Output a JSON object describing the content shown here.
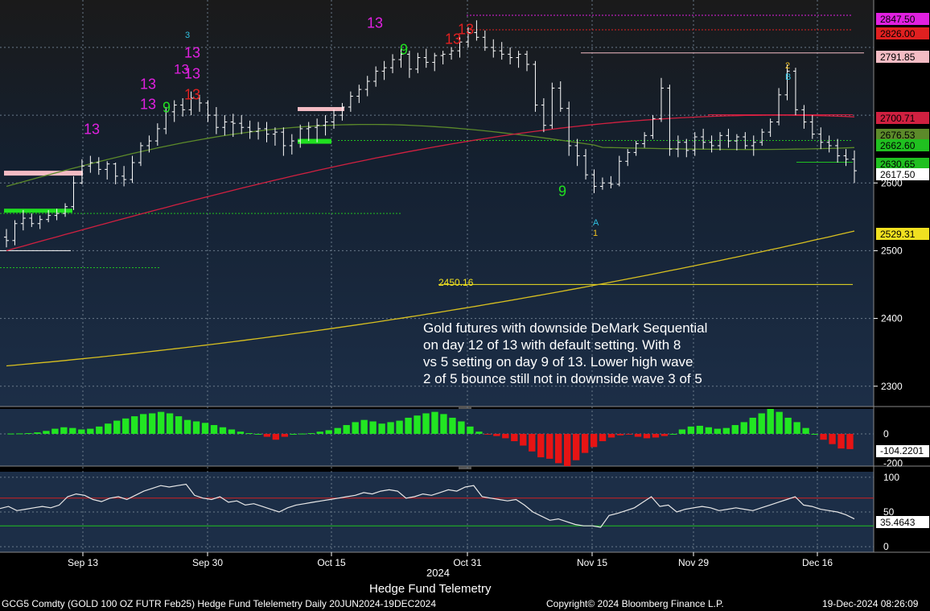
{
  "chart_data": [
    {
      "type": "candlestick",
      "panel": "price",
      "yticks": [
        2300,
        2400,
        2500,
        2600
      ],
      "ylim": [
        2270,
        2870
      ],
      "ohlc": [
        [
          2520,
          2532,
          2505,
          2515
        ],
        [
          2515,
          2545,
          2508,
          2540
        ],
        [
          2540,
          2560,
          2530,
          2548
        ],
        [
          2548,
          2555,
          2535,
          2540
        ],
        [
          2540,
          2552,
          2532,
          2546
        ],
        [
          2546,
          2560,
          2542,
          2552
        ],
        [
          2552,
          2562,
          2545,
          2555
        ],
        [
          2555,
          2570,
          2550,
          2565
        ],
        [
          2565,
          2610,
          2560,
          2600
        ],
        [
          2600,
          2635,
          2598,
          2625
        ],
        [
          2625,
          2640,
          2615,
          2630
        ],
        [
          2630,
          2638,
          2612,
          2620
        ],
        [
          2620,
          2632,
          2605,
          2628
        ],
        [
          2628,
          2630,
          2598,
          2610
        ],
        [
          2610,
          2625,
          2595,
          2605
        ],
        [
          2605,
          2640,
          2600,
          2630
        ],
        [
          2630,
          2660,
          2625,
          2655
        ],
        [
          2655,
          2670,
          2645,
          2662
        ],
        [
          2662,
          2688,
          2655,
          2680
        ],
        [
          2680,
          2712,
          2672,
          2705
        ],
        [
          2705,
          2722,
          2690,
          2715
        ],
        [
          2715,
          2725,
          2698,
          2708
        ],
        [
          2708,
          2735,
          2700,
          2725
        ],
        [
          2725,
          2730,
          2705,
          2718
        ],
        [
          2718,
          2722,
          2690,
          2700
        ],
        [
          2700,
          2712,
          2672,
          2682
        ],
        [
          2682,
          2700,
          2670,
          2690
        ],
        [
          2690,
          2702,
          2668,
          2688
        ],
        [
          2688,
          2700,
          2672,
          2682
        ],
        [
          2682,
          2692,
          2665,
          2676
        ],
        [
          2676,
          2690,
          2664,
          2680
        ],
        [
          2680,
          2690,
          2660,
          2672
        ],
        [
          2672,
          2682,
          2655,
          2675
        ],
        [
          2675,
          2682,
          2640,
          2655
        ],
        [
          2655,
          2672,
          2642,
          2662
        ],
        [
          2662,
          2686,
          2652,
          2680
        ],
        [
          2680,
          2690,
          2662,
          2682
        ],
        [
          2682,
          2695,
          2660,
          2685
        ],
        [
          2685,
          2700,
          2670,
          2690
        ],
        [
          2690,
          2708,
          2680,
          2700
        ],
        [
          2700,
          2718,
          2692,
          2712
        ],
        [
          2712,
          2735,
          2705,
          2728
        ],
        [
          2728,
          2745,
          2718,
          2738
        ],
        [
          2738,
          2758,
          2728,
          2750
        ],
        [
          2750,
          2772,
          2742,
          2765
        ],
        [
          2765,
          2780,
          2752,
          2770
        ],
        [
          2770,
          2790,
          2762,
          2782
        ],
        [
          2782,
          2800,
          2770,
          2790
        ],
        [
          2790,
          2795,
          2755,
          2768
        ],
        [
          2768,
          2792,
          2762,
          2785
        ],
        [
          2785,
          2798,
          2770,
          2778
        ],
        [
          2778,
          2792,
          2765,
          2788
        ],
        [
          2788,
          2795,
          2775,
          2790
        ],
        [
          2790,
          2800,
          2782,
          2795
        ],
        [
          2795,
          2815,
          2785,
          2808
        ],
        [
          2808,
          2830,
          2800,
          2822
        ],
        [
          2822,
          2840,
          2810,
          2815
        ],
        [
          2815,
          2825,
          2795,
          2800
        ],
        [
          2800,
          2812,
          2785,
          2795
        ],
        [
          2795,
          2808,
          2782,
          2790
        ],
        [
          2790,
          2800,
          2775,
          2785
        ],
        [
          2785,
          2795,
          2770,
          2790
        ],
        [
          2790,
          2795,
          2765,
          2775
        ],
        [
          2775,
          2780,
          2705,
          2715
        ],
        [
          2715,
          2725,
          2675,
          2685
        ],
        [
          2685,
          2748,
          2680,
          2740
        ],
        [
          2740,
          2750,
          2705,
          2710
        ],
        [
          2710,
          2720,
          2640,
          2655
        ],
        [
          2655,
          2665,
          2625,
          2640
        ],
        [
          2640,
          2650,
          2605,
          2612
        ],
        [
          2612,
          2620,
          2585,
          2595
        ],
        [
          2595,
          2608,
          2590,
          2600
        ],
        [
          2600,
          2610,
          2592,
          2598
        ],
        [
          2598,
          2640,
          2595,
          2632
        ],
        [
          2632,
          2650,
          2625,
          2645
        ],
        [
          2645,
          2662,
          2640,
          2658
        ],
        [
          2658,
          2675,
          2652,
          2670
        ],
        [
          2670,
          2700,
          2665,
          2695
        ],
        [
          2695,
          2755,
          2690,
          2740
        ],
        [
          2740,
          2745,
          2640,
          2650
        ],
        [
          2650,
          2670,
          2638,
          2660
        ],
        [
          2660,
          2665,
          2638,
          2648
        ],
        [
          2648,
          2675,
          2640,
          2668
        ],
        [
          2668,
          2680,
          2650,
          2660
        ],
        [
          2660,
          2670,
          2645,
          2655
        ],
        [
          2655,
          2675,
          2648,
          2670
        ],
        [
          2670,
          2680,
          2652,
          2662
        ],
        [
          2662,
          2672,
          2648,
          2668
        ],
        [
          2668,
          2675,
          2650,
          2655
        ],
        [
          2655,
          2670,
          2640,
          2660
        ],
        [
          2660,
          2680,
          2655,
          2675
        ],
        [
          2675,
          2695,
          2668,
          2690
        ],
        [
          2690,
          2740,
          2685,
          2730
        ],
        [
          2730,
          2775,
          2722,
          2765
        ],
        [
          2765,
          2770,
          2700,
          2708
        ],
        [
          2708,
          2715,
          2680,
          2690
        ],
        [
          2690,
          2700,
          2665,
          2672
        ],
        [
          2672,
          2682,
          2650,
          2660
        ],
        [
          2660,
          2670,
          2645,
          2655
        ],
        [
          2655,
          2665,
          2630,
          2640
        ],
        [
          2640,
          2650,
          2625,
          2635
        ],
        [
          2635,
          2648,
          2600,
          2618
        ]
      ],
      "moving_averages": [
        {
          "color": "#5c8a2a",
          "from": 2595,
          "to": 2675
        },
        {
          "color": "#d02040",
          "from": 2500,
          "to": 2700
        },
        {
          "color": "#d8c020",
          "from": 2330,
          "to": 2529
        }
      ],
      "value_labels": [
        {
          "text": "2847.50",
          "color": "#e020e0"
        },
        {
          "text": "2826.00",
          "color": "#e02020"
        },
        {
          "text": "2791.85",
          "color": "#f4bcc4"
        },
        {
          "text": "2700.71",
          "color": "#d02040"
        },
        {
          "text": "2676.53",
          "color": "#5c8a2a"
        },
        {
          "text": "2662.60",
          "color": "#20c020"
        },
        {
          "text": "2630.65",
          "color": "#20c020"
        },
        {
          "text": "2617.50",
          "color": "#ffffff"
        },
        {
          "text": "2529.31",
          "color": "#f0e020"
        }
      ],
      "reference_line": {
        "value": 2450.16,
        "label": "2450.16"
      },
      "sequential_counts": [
        {
          "text": "13",
          "color": "#e020e0"
        },
        {
          "text": "13",
          "color": "#e020e0"
        },
        {
          "text": "13",
          "color": "#e020e0"
        },
        {
          "text": "13",
          "color": "#e020e0"
        },
        {
          "text": "13",
          "color": "#e020e0"
        },
        {
          "text": "13",
          "color": "#e020e0"
        },
        {
          "text": "13",
          "color": "#e020e0"
        },
        {
          "text": "13",
          "color": "#e02020"
        },
        {
          "text": "13",
          "color": "#e02020"
        },
        {
          "text": "13",
          "color": "#e02020"
        },
        {
          "text": "9",
          "color": "#20e020"
        },
        {
          "text": "9",
          "color": "#20e020"
        },
        {
          "text": "9",
          "color": "#20e020"
        },
        {
          "text": "3",
          "color": "#30c0e0"
        },
        {
          "text": "A",
          "color": "#30c0e0"
        },
        {
          "text": "B",
          "color": "#30c0e0"
        },
        {
          "text": "2",
          "color": "#f0c020"
        },
        {
          "text": "1",
          "color": "#f0c020"
        }
      ],
      "annotation": "Gold futures with downside DeMark Sequential on day 12 of 13 with default setting.  With 8 vs 5 setting on day 9 of 13.  Lower high wave 2 of 5 bounce still not in downside wave 3 of 5",
      "annotation_lines": [
        "Gold futures with downside DeMark Sequential",
        "on day 12 of 13 with default setting.  With 8",
        "vs 5 setting on day 9 of 13.  Lower high wave",
        "2 of 5 bounce still not in downside wave 3 of 5"
      ]
    },
    {
      "type": "bar",
      "panel": "histogram",
      "yticks": [
        0,
        -200
      ],
      "ylim": [
        -220,
        170
      ],
      "last_label": "-104.2201",
      "values": [
        2,
        3,
        5,
        10,
        20,
        35,
        45,
        40,
        30,
        35,
        50,
        70,
        90,
        105,
        120,
        135,
        140,
        150,
        140,
        120,
        95,
        85,
        75,
        60,
        45,
        30,
        15,
        5,
        0,
        -20,
        -40,
        -20,
        0,
        2,
        5,
        15,
        25,
        40,
        60,
        80,
        95,
        85,
        70,
        80,
        90,
        110,
        125,
        140,
        150,
        135,
        110,
        85,
        50,
        15,
        -5,
        -15,
        -30,
        -50,
        -80,
        -120,
        -160,
        -170,
        -200,
        -220,
        -180,
        -130,
        -90,
        -50,
        -25,
        -10,
        -5,
        -20,
        -30,
        -25,
        -15,
        0,
        30,
        50,
        55,
        45,
        35,
        40,
        60,
        80,
        110,
        140,
        170,
        150,
        110,
        80,
        40,
        0,
        -40,
        -70,
        -100,
        -104
      ]
    },
    {
      "type": "line",
      "panel": "oscillator",
      "yticks": [
        0,
        50,
        100
      ],
      "ylim": [
        -8,
        108
      ],
      "levels": [
        70,
        30
      ],
      "last_label": "35.4643",
      "values": [
        55,
        58,
        52,
        54,
        56,
        58,
        56,
        60,
        72,
        76,
        74,
        68,
        65,
        70,
        72,
        68,
        74,
        80,
        84,
        88,
        86,
        88,
        90,
        74,
        70,
        68,
        72,
        64,
        66,
        60,
        62,
        58,
        54,
        50,
        56,
        60,
        62,
        64,
        66,
        68,
        70,
        72,
        74,
        78,
        76,
        80,
        82,
        80,
        70,
        72,
        76,
        74,
        78,
        82,
        80,
        86,
        88,
        72,
        70,
        68,
        66,
        68,
        60,
        50,
        44,
        38,
        40,
        36,
        32,
        30,
        30,
        28,
        45,
        48,
        52,
        56,
        64,
        72,
        58,
        60,
        50,
        54,
        56,
        58,
        56,
        52,
        54,
        56,
        54,
        52,
        56,
        60,
        64,
        68,
        72,
        60,
        58,
        54,
        52,
        50,
        46,
        40
      ]
    }
  ],
  "axis": {
    "x_ticks": [
      "Sep 13",
      "Sep 30",
      "Oct 15",
      "Oct 31",
      "Nov 15",
      "Nov 29",
      "Dec 16"
    ],
    "year": "2024",
    "title": "Hedge Fund Telemetry"
  },
  "footer": {
    "left": "GCG5 Comdty (GOLD 100 OZ FUTR  Feb25) Hedge Fund Telelemetry  Daily 20JUN2024-19DEC2024",
    "center": "Copyright© 2024 Bloomberg Finance L.P.",
    "right": "19-Dec-2024 08:26:09"
  }
}
